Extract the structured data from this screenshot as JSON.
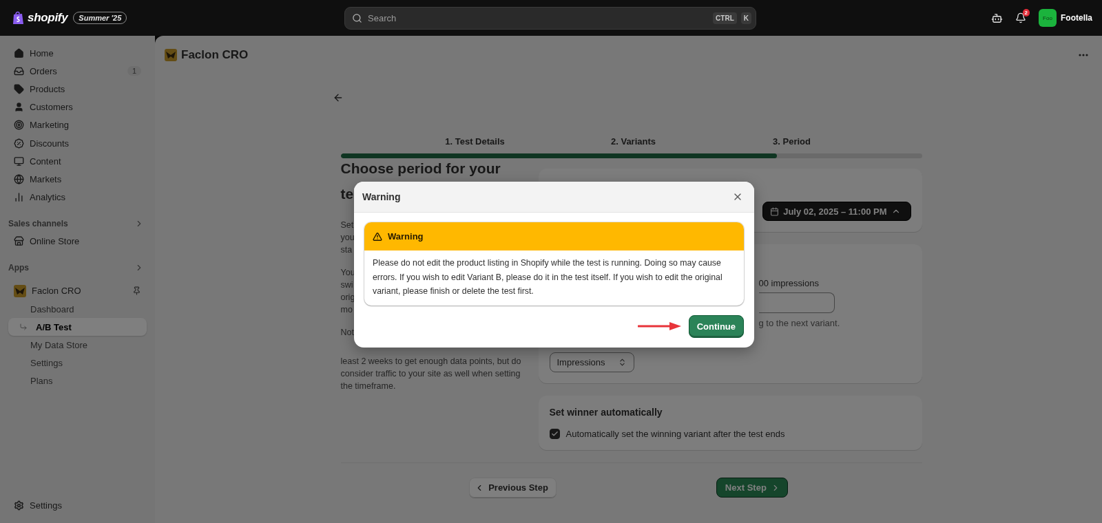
{
  "top_bar": {
    "logo": "shopify",
    "edition_badge": "Summer '25",
    "search": {
      "placeholder": "Search",
      "shortcut": [
        "CTRL",
        "K"
      ]
    },
    "notifications_count": "2",
    "account": {
      "avatar": "Foo",
      "name": "Footella"
    }
  },
  "sidebar": {
    "nav": [
      {
        "label": "Home",
        "selected": false
      },
      {
        "label": "Orders",
        "badge": "1",
        "selected": false
      },
      {
        "label": "Products",
        "selected": false
      },
      {
        "label": "Customers",
        "selected": false
      },
      {
        "label": "Marketing",
        "selected": false
      },
      {
        "label": "Discounts",
        "selected": false
      },
      {
        "label": "Content",
        "selected": false
      },
      {
        "label": "Markets",
        "selected": false
      },
      {
        "label": "Analytics",
        "selected": false
      }
    ],
    "sections": [
      {
        "title": "Sales channels",
        "items": [
          {
            "label": "Online Store",
            "pinned": false,
            "selected": false
          }
        ]
      },
      {
        "title": "Apps",
        "items": [
          {
            "label": "Faclon CRO",
            "pinned": true,
            "selected": false,
            "children": [
              {
                "label": "Dashboard",
                "selected": false
              },
              {
                "label": "A/B Test",
                "selected": true
              },
              {
                "label": "My Data Store",
                "selected": false
              },
              {
                "label": "Settings",
                "selected": false
              },
              {
                "label": "Plans",
                "selected": false
              }
            ]
          }
        ]
      }
    ],
    "footer_item": {
      "label": "Settings"
    }
  },
  "page": {
    "app_title": "Faclon CRO",
    "steps": [
      "1. Test Details",
      "2. Variants",
      "3. Period"
    ],
    "progress": {
      "level": 0.75
    },
    "heading_lines": [
      "Choose period for your",
      "te"
    ],
    "paragraphs": [
      [
        "Set",
        "you",
        "sta"
      ],
      [
        "You",
        "swi",
        "orig",
        "mo"
      ],
      [
        "Not",
        "least 2 weeks to get enough data points, but do",
        "consider traffic to your site as well when setting",
        "the timeframe."
      ]
    ],
    "period_card": {
      "date_button": "July 02, 2025 – 11:00 PM"
    },
    "goal_card": {
      "label": "00 impressions",
      "hint": "g to the next variant.",
      "select": "Impressions"
    },
    "winner_card": {
      "title": "Set winner automatically",
      "checkbox": {
        "label": "Automatically set the winning variant after the test ends",
        "checked": true
      }
    },
    "buttons": {
      "previous": "Previous Step",
      "next": "Next Step"
    }
  },
  "modal": {
    "title": "Warning",
    "banner": {
      "title": "Warning",
      "text": "Please do not edit the product listing in Shopify while the test is running. Doing so may cause errors. If you wish to edit Variant B, please do it in the test itself. If you wish to edit the original variant, please finish or delete the test first."
    },
    "primary_button": "Continue"
  }
}
